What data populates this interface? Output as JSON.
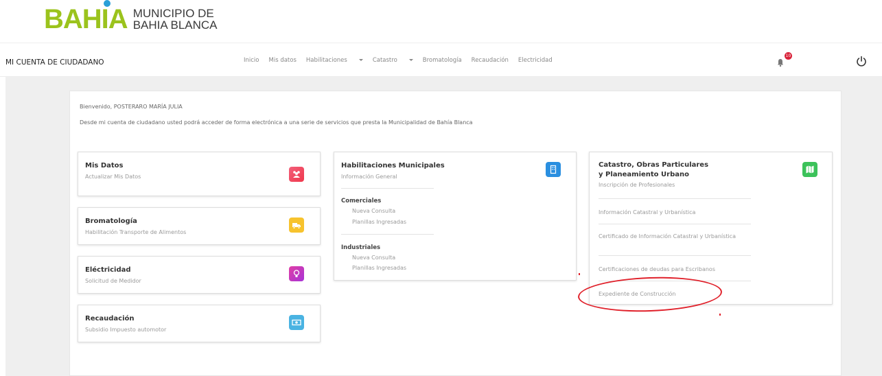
{
  "logo": {
    "word_a": "BAH",
    "word_i": "I",
    "word_b": "A",
    "sub1": "MUNICIPIO DE",
    "sub2": "BAHIA BLANCA"
  },
  "navbar": {
    "brand": "MI CUENTA DE CIUDADANO",
    "links": [
      "Inicio",
      "Mis datos",
      "Habilitaciones",
      "Catastro",
      "Bromatología",
      "Recaudación",
      "Electricidad"
    ],
    "notifications": "10"
  },
  "welcome": "Bienvenido, POSTERARO MARÍA JULIA",
  "intro": "Desde mi cuenta de ciudadano usted podrá acceder de forma electrónica a una serie de servicios que presta la Municipalidad de Bahía Blanca",
  "cards": {
    "mis_datos": {
      "title": "Mis Datos",
      "sub": "Actualizar Mis Datos",
      "color": "#f0384c"
    },
    "bromatologia": {
      "title": "Bromatología",
      "sub": "Habilitación Transporte de Alimentos",
      "color": "#f7c32e"
    },
    "electricidad": {
      "title": "Eléctricidad",
      "sub": "Solicitud de Medidor",
      "color": "#c83ac2"
    },
    "recaudacion": {
      "title": "Recaudación",
      "sub": "Subsidio Impuesto automotor",
      "color": "#4ab3e2"
    },
    "habilitaciones": {
      "title": "Habilitaciones Municipales",
      "sub": "Información General",
      "color": "#2a8fe0",
      "comerciales": {
        "label": "Comerciales",
        "items": [
          "Nueva Consulta",
          "Planillas Ingresadas"
        ]
      },
      "industriales": {
        "label": "Industriales",
        "items": [
          "Nueva Consulta",
          "Planillas Ingresadas"
        ]
      }
    },
    "catastro": {
      "title1": "Catastro, Obras Particulares",
      "title2": "y Planeamiento Urbano",
      "sub": "Inscripción de Profesionales",
      "color": "#3cc25a",
      "items": [
        "Información Catastral y Urbanística",
        "Certificado de Información Catastral y Urbanística",
        "Certificaciones de deudas para Escribanos",
        "Expediente de Construcción"
      ]
    }
  }
}
